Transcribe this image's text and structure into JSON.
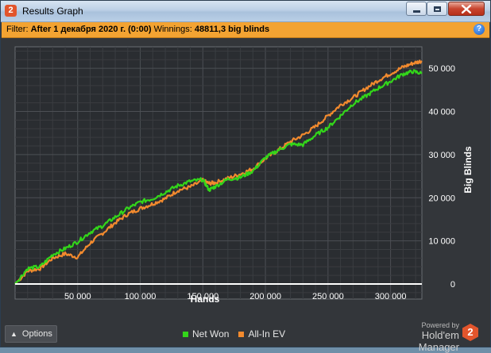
{
  "window": {
    "title": "Results Graph",
    "app_badge": "2",
    "buttons": [
      "minimize",
      "maximize",
      "close"
    ]
  },
  "filter": {
    "prefix": "Filter:",
    "value": "After 1 декабря 2020 г. (0:00)",
    "winnings_label": "Winnings:",
    "winnings_value": "48811,3 big blinds",
    "help_icon": "help-icon"
  },
  "chart_data": {
    "type": "line",
    "title": "",
    "xlabel": "Hands",
    "ylabel": "Big Blinds",
    "xlim": [
      0,
      325000
    ],
    "ylim": [
      -3500,
      55000
    ],
    "x_ticks": [
      50000,
      100000,
      150000,
      200000,
      250000,
      300000
    ],
    "x_tick_labels": [
      "50 000",
      "100 000",
      "150 000",
      "200 000",
      "250 000",
      "300 000"
    ],
    "y_ticks": [
      0,
      10000,
      20000,
      30000,
      40000,
      50000
    ],
    "y_tick_labels": [
      "0",
      "10 000",
      "20 000",
      "30 000",
      "40 000",
      "50 000"
    ],
    "grid": true,
    "series": [
      {
        "name": "Net Won",
        "color": "#33d61a",
        "x": [
          0,
          10000,
          20000,
          30000,
          40000,
          50000,
          60000,
          70000,
          80000,
          90000,
          100000,
          110000,
          120000,
          130000,
          140000,
          150000,
          155000,
          160000,
          170000,
          180000,
          190000,
          200000,
          210000,
          220000,
          230000,
          240000,
          250000,
          260000,
          270000,
          280000,
          290000,
          300000,
          310000,
          318000,
          325000
        ],
        "y": [
          0,
          3600,
          4000,
          6800,
          8200,
          9800,
          12000,
          13500,
          15500,
          17500,
          19000,
          19800,
          21300,
          22800,
          23800,
          24200,
          21800,
          22600,
          24300,
          24700,
          26200,
          29300,
          31000,
          32400,
          32300,
          34500,
          36300,
          39000,
          41800,
          43500,
          45400,
          47000,
          48700,
          49300,
          48800
        ]
      },
      {
        "name": "All-In EV",
        "color": "#f28a2e",
        "x": [
          0,
          10000,
          20000,
          30000,
          40000,
          50000,
          60000,
          70000,
          80000,
          90000,
          100000,
          110000,
          120000,
          130000,
          140000,
          150000,
          155000,
          160000,
          170000,
          180000,
          190000,
          200000,
          210000,
          220000,
          230000,
          240000,
          250000,
          260000,
          270000,
          280000,
          290000,
          300000,
          310000,
          318000,
          325000
        ],
        "y": [
          0,
          3000,
          3600,
          6000,
          7000,
          6200,
          9500,
          11800,
          14200,
          16200,
          17500,
          18600,
          19800,
          21700,
          22500,
          24000,
          23300,
          23500,
          24500,
          25500,
          26700,
          29100,
          31000,
          33000,
          34500,
          36500,
          39000,
          41500,
          43200,
          45300,
          47200,
          48800,
          50300,
          51200,
          51700
        ]
      }
    ],
    "zero_line_color": "#ffffff"
  },
  "bottom": {
    "options_label": "Options",
    "legend": [
      {
        "label": "Net Won",
        "color": "#33d61a"
      },
      {
        "label": "All-In EV",
        "color": "#f28a2e"
      }
    ],
    "powered_by": "Powered by",
    "product_name": "Hold'em Manager",
    "product_badge": "2"
  }
}
